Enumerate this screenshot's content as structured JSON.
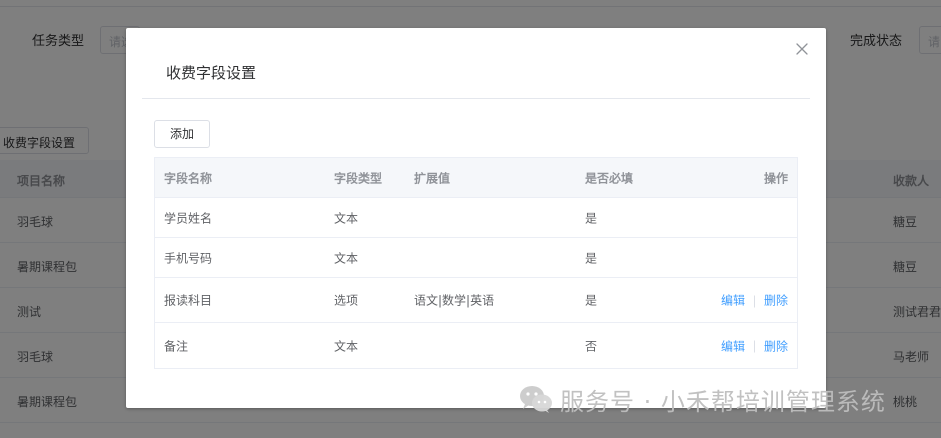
{
  "background": {
    "filters": {
      "task_type_label": "任务类型",
      "task_type_placeholder": "请选",
      "status_label": "完成状态",
      "status_placeholder": "请"
    },
    "fee_fields_button": "收费字段设置",
    "table": {
      "headers": [
        "项目名称",
        "收款人"
      ],
      "rows": [
        {
          "project": "羽毛球",
          "payee": "糖豆"
        },
        {
          "project": "暑期课程包",
          "payee": "糖豆"
        },
        {
          "project": "测试",
          "payee": "测试君君"
        },
        {
          "project": "羽毛球",
          "payee": "马老师"
        },
        {
          "project": "暑期课程包",
          "payee": "桃桃"
        }
      ]
    }
  },
  "dialog": {
    "title": "收费字段设置",
    "add_button": "添加",
    "table": {
      "headers": {
        "name": "字段名称",
        "type": "字段类型",
        "ext": "扩展值",
        "required": "是否必填",
        "ops": "操作"
      },
      "rows": [
        {
          "name": "学员姓名",
          "type": "文本",
          "ext": "",
          "required": "是",
          "ops": []
        },
        {
          "name": "手机号码",
          "type": "文本",
          "ext": "",
          "required": "是",
          "ops": []
        },
        {
          "name": "报读科目",
          "type": "选项",
          "ext": "语文|数学|英语",
          "required": "是",
          "ops": [
            "编辑",
            "删除"
          ]
        },
        {
          "name": "备注",
          "type": "文本",
          "ext": "",
          "required": "否",
          "ops": [
            "编辑",
            "删除"
          ]
        }
      ]
    }
  },
  "watermark": {
    "text": "服务号 · 小禾帮培训管理系统"
  },
  "colors": {
    "link": "#409eff",
    "overlay": "rgba(0,0,0,0.5)"
  }
}
